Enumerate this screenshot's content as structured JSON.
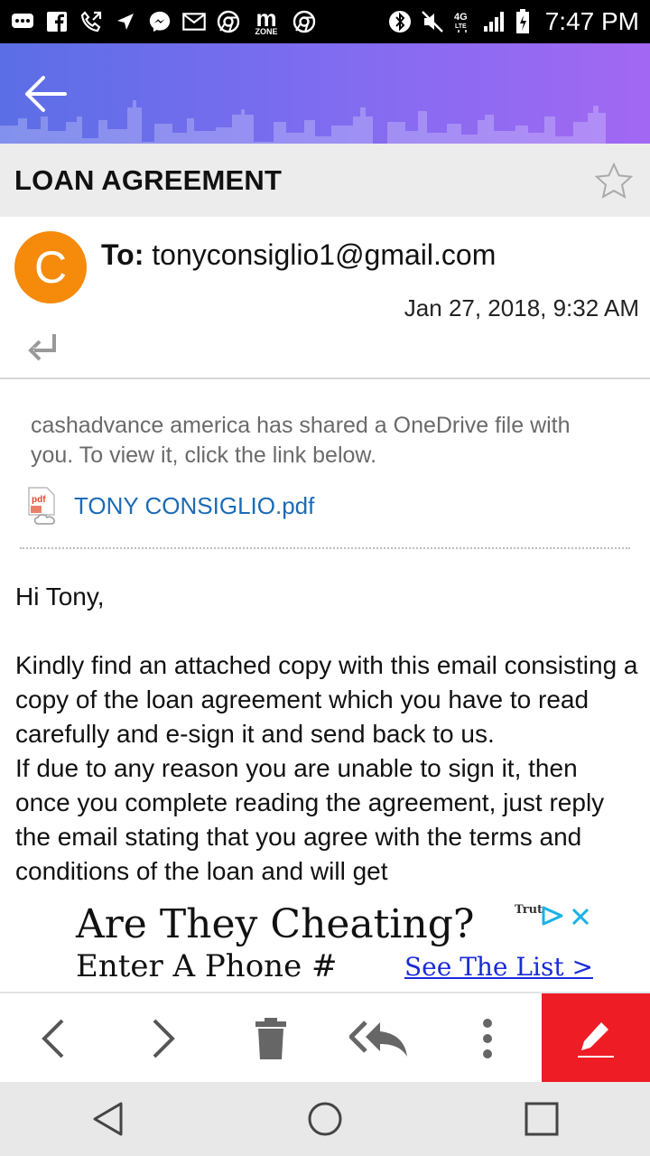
{
  "status_bar": {
    "time": "7:47 PM",
    "network": "4G LTE",
    "icons": [
      "messages-icon",
      "facebook-icon",
      "phone-forward-icon",
      "location-icon",
      "messenger-icon",
      "gmail-icon",
      "chrome-icon",
      "zone-icon",
      "chrome-icon",
      "bluetooth-icon",
      "mute-icon",
      "signal-icon",
      "battery-icon"
    ],
    "zone_label": "m",
    "zone_sub": "ZONE"
  },
  "email": {
    "subject": "LOAN AGREEMENT",
    "avatar_letter": "C",
    "avatar_color": "#f58a0b",
    "to_label": "To:",
    "to_address": "tonyconsiglio1@gmail.com",
    "date": "Jan 27, 2018, 9:32 AM",
    "share_text": "cashadvance america has shared a OneDrive file with you. To view it, click the link below.",
    "attachment_name": "TONY CONSIGLIO.pdf",
    "greeting": "Hi Tony,",
    "paragraph1": "Kindly find an attached copy with this email consisting a copy of the loan agreement which you have to read carefully and e-sign it and send back to us.",
    "paragraph2": "If due to any reason you are unable to sign it, then once you complete reading the agreement, just reply the email stating that you agree with the terms and conditions of the loan and will get"
  },
  "ad": {
    "headline": "Are They Cheating?",
    "subline": "Enter A Phone #",
    "link": "See The List >",
    "brand": "Trut"
  },
  "colors": {
    "accent_gradient_start": "#5b6ee6",
    "accent_gradient_end": "#a268f3",
    "compose_button": "#ee1c25",
    "link": "#1b6bb5"
  }
}
